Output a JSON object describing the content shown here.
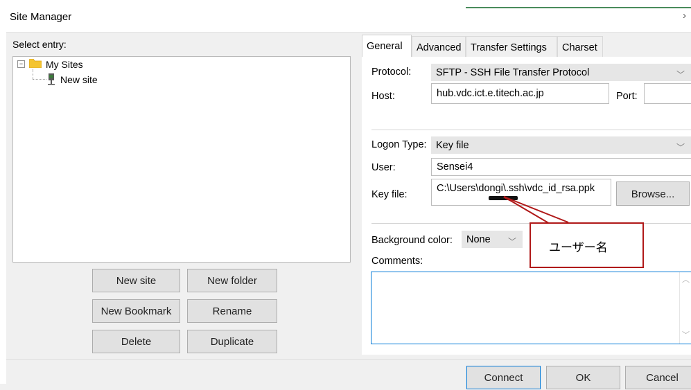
{
  "window": {
    "title": "Site Manager",
    "close_glyph": "›"
  },
  "left": {
    "select_entry_label": "Select entry:",
    "tree": {
      "root_label": "My Sites",
      "root_toggle": "−",
      "child_label": "New site"
    },
    "buttons": {
      "new_site": "New site",
      "new_folder": "New folder",
      "new_bookmark": "New Bookmark",
      "rename": "Rename",
      "delete": "Delete",
      "duplicate": "Duplicate"
    }
  },
  "tabs": [
    "General",
    "Advanced",
    "Transfer Settings",
    "Charset"
  ],
  "general": {
    "protocol_label": "Protocol:",
    "protocol_value": "SFTP - SSH File Transfer Protocol",
    "host_label": "Host:",
    "host_value": "hub.vdc.ict.e.titech.ac.jp",
    "port_label": "Port:",
    "port_value": "",
    "logon_type_label": "Logon Type:",
    "logon_type_value": "Key file",
    "user_label": "User:",
    "user_value": "Sensei4",
    "key_file_label": "Key file:",
    "key_file_value": "C:\\Users\\dongi\\.ssh\\vdc_id_rsa.ppk",
    "browse_label": "Browse...",
    "background_color_label": "Background color:",
    "background_color_value": "None",
    "comments_label": "Comments:",
    "comments_value": ""
  },
  "annotation": {
    "text": "ユーザー名",
    "color": "#b01818"
  },
  "footer": {
    "connect": "Connect",
    "ok": "OK",
    "cancel": "Cancel"
  },
  "icons": {
    "chevron": "chevron-down-icon",
    "folder": "folder-icon",
    "site": "site-icon"
  },
  "colors": {
    "accent_border": "#0078d7",
    "folder": "#f4c430",
    "panel_bg": "#ffffff",
    "dialog_bg": "#f0f0f0"
  }
}
